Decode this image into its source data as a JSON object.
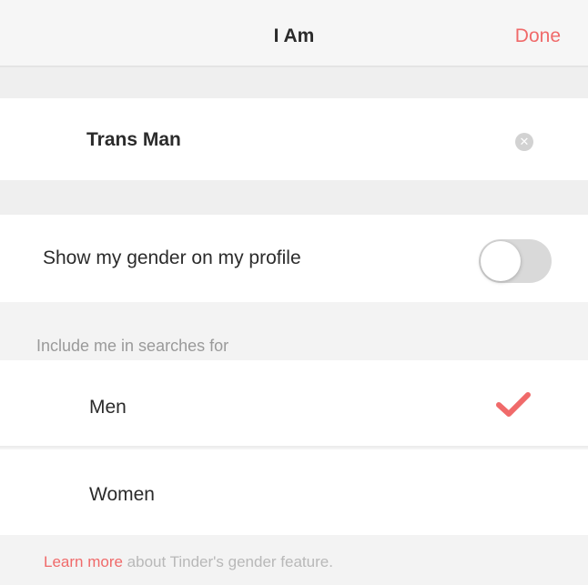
{
  "nav": {
    "title": "I Am",
    "done_label": "Done"
  },
  "gender": {
    "value": "Trans Man",
    "clear_icon": "clear-x-icon"
  },
  "show_gender": {
    "label": "Show my gender on my profile",
    "enabled": false
  },
  "search": {
    "header": "Include me in searches for",
    "options": [
      {
        "label": "Men",
        "selected": true
      },
      {
        "label": "Women",
        "selected": false
      }
    ]
  },
  "footer": {
    "link_text": "Learn more",
    "rest_text": " about Tinder's gender feature."
  },
  "colors": {
    "accent": "#f06a6a",
    "background": "#efefef",
    "row": "#ffffff",
    "toggle_off": "#d9d9d9"
  }
}
